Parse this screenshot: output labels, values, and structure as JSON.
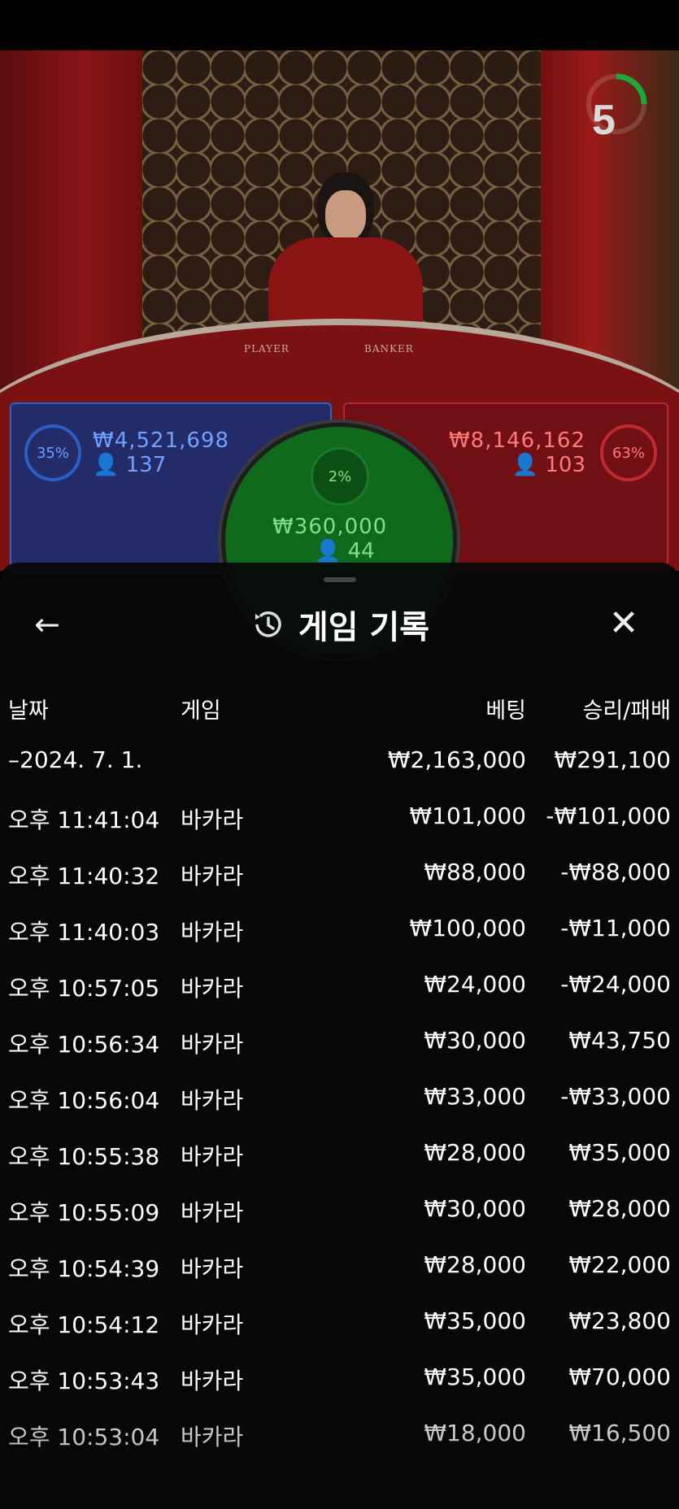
{
  "scene": {
    "table_labels": {
      "player": "PLAYER",
      "banker": "BANKER"
    },
    "timer": "5",
    "player": {
      "pct": "35%",
      "amount": "₩4,521,698",
      "count": "137"
    },
    "banker": {
      "pct": "63%",
      "amount": "₩8,146,162",
      "count": "103"
    },
    "tie": {
      "pct": "2%",
      "amount": "₩360,000",
      "count": "44"
    },
    "colors": {
      "player": "#2f63c8",
      "banker": "#b4262c",
      "tie": "#0f6a1c"
    }
  },
  "history": {
    "title": "게임 기록",
    "icons": {
      "back": "arrow-left-icon",
      "history": "history-icon",
      "close": "close-icon"
    },
    "headers": {
      "date": "날짜",
      "game": "게임",
      "bet": "베팅",
      "win": "승리/패배"
    },
    "day_summary": {
      "date": "–2024. 7. 1.",
      "bet": "₩2,163,000",
      "win": "₩291,100"
    },
    "rows": [
      {
        "time": "오후 11:41:04",
        "game": "바카라",
        "bet": "₩101,000",
        "win": "-₩101,000"
      },
      {
        "time": "오후 11:40:32",
        "game": "바카라",
        "bet": "₩88,000",
        "win": "-₩88,000"
      },
      {
        "time": "오후 11:40:03",
        "game": "바카라",
        "bet": "₩100,000",
        "win": "-₩11,000"
      },
      {
        "time": "오후 10:57:05",
        "game": "바카라",
        "bet": "₩24,000",
        "win": "-₩24,000"
      },
      {
        "time": "오후 10:56:34",
        "game": "바카라",
        "bet": "₩30,000",
        "win": "₩43,750"
      },
      {
        "time": "오후 10:56:04",
        "game": "바카라",
        "bet": "₩33,000",
        "win": "-₩33,000"
      },
      {
        "time": "오후 10:55:38",
        "game": "바카라",
        "bet": "₩28,000",
        "win": "₩35,000"
      },
      {
        "time": "오후 10:55:09",
        "game": "바카라",
        "bet": "₩30,000",
        "win": "₩28,000"
      },
      {
        "time": "오후 10:54:39",
        "game": "바카라",
        "bet": "₩28,000",
        "win": "₩22,000"
      },
      {
        "time": "오후 10:54:12",
        "game": "바카라",
        "bet": "₩35,000",
        "win": "₩23,800"
      },
      {
        "time": "오후 10:53:43",
        "game": "바카라",
        "bet": "₩35,000",
        "win": "₩70,000"
      },
      {
        "time": "오후 10:53:04",
        "game": "바카라",
        "bet": "₩18,000",
        "win": "₩16,500"
      }
    ]
  }
}
